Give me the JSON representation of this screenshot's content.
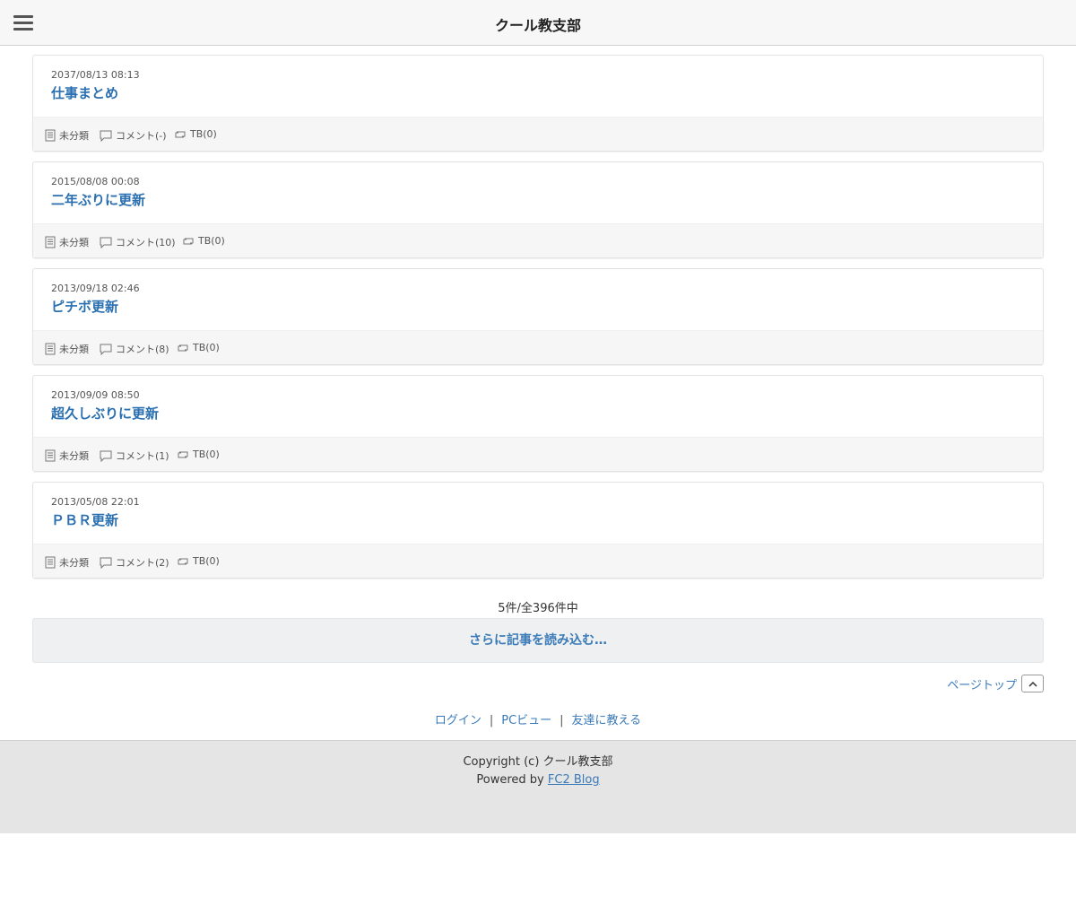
{
  "header": {
    "title": "クール教支部"
  },
  "entries": [
    {
      "date": "2037/08/13 08:13",
      "title": "仕事まとめ",
      "category": "未分類",
      "comments": "コメント(-)",
      "tb": "TB(0)"
    },
    {
      "date": "2015/08/08 00:08",
      "title": "二年ぶりに更新",
      "category": "未分類",
      "comments": "コメント(10)",
      "tb": "TB(0)"
    },
    {
      "date": "2013/09/18 02:46",
      "title": "ピチボ更新",
      "category": "未分類",
      "comments": "コメント(8)",
      "tb": "TB(0)"
    },
    {
      "date": "2013/09/09 08:50",
      "title": "超久しぶりに更新",
      "category": "未分類",
      "comments": "コメント(1)",
      "tb": "TB(0)"
    },
    {
      "date": "2013/05/08 22:01",
      "title": "ＰＢＲ更新",
      "category": "未分類",
      "comments": "コメント(2)",
      "tb": "TB(0)"
    }
  ],
  "pagination": {
    "count_text": "5件/全396件中",
    "load_more": "さらに記事を読み込む…"
  },
  "pagetop": {
    "label": "ページトップ"
  },
  "footer_links": {
    "login": "ログイン",
    "sep": "|",
    "pc_view": "PCビュー",
    "tell_friend": "友達に教える"
  },
  "footer": {
    "copyright": "Copyright (c) クール教支部",
    "powered_prefix": "Powered by",
    "powered_link": "FC2 Blog"
  },
  "icons": {
    "menu": "hamburger-icon",
    "category": "document-icon",
    "comment": "speech-bubble-icon",
    "trackback": "trackback-icon",
    "pagetop": "chevron-up-icon"
  },
  "colors": {
    "link": "#2a6fb0",
    "header_bg": "#f7f7f7",
    "footer_bg": "#e5e5e5"
  }
}
